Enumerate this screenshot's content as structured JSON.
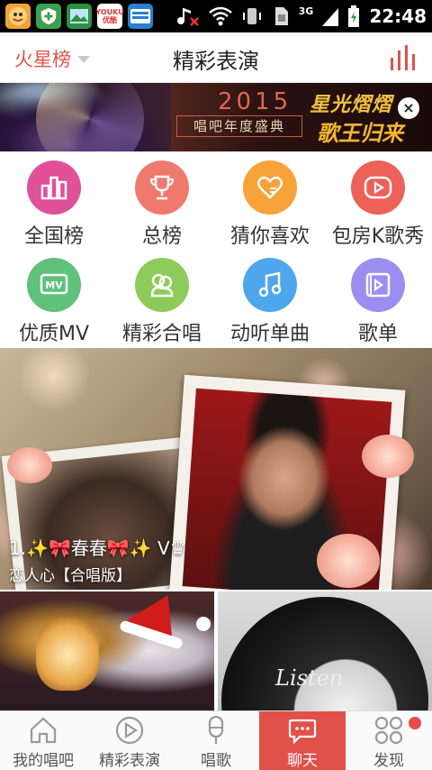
{
  "status_bar": {
    "time": "22:48",
    "network": "3G",
    "apps": [
      {
        "icon": "game-app-icon",
        "color": "#f0a43a"
      },
      {
        "icon": "security-app-icon",
        "color": "#3aa14a"
      },
      {
        "icon": "gallery-app-icon",
        "color": "#2f8f3f"
      },
      {
        "icon": "youku-app-icon",
        "color": "#ffffff",
        "text": "YOUKU 优酷"
      },
      {
        "icon": "store-app-icon",
        "color": "#2a7fd3"
      }
    ]
  },
  "header": {
    "left_label": "火星榜",
    "title": "精彩表演",
    "right_icon": "chart-icon"
  },
  "banner": {
    "year": "2015",
    "subtitle": "唱吧年度盛典",
    "calligraphy_line1": "星光熠熠",
    "calligraphy_line2": "歌王归来",
    "close_symbol": "×"
  },
  "categories": [
    {
      "label": "全国榜",
      "icon": "chart-icon",
      "color": "#e0519a"
    },
    {
      "label": "总榜",
      "icon": "trophy-icon",
      "color": "#f0796d"
    },
    {
      "label": "猜你喜欢",
      "icon": "heart-icon",
      "color": "#f8a23a"
    },
    {
      "label": "包房K歌秀",
      "icon": "play-icon",
      "color": "#ec6158"
    },
    {
      "label": "优质MV",
      "icon": "mv-icon",
      "color": "#5fc17a"
    },
    {
      "label": "精彩合唱",
      "icon": "duet-icon",
      "color": "#8ecb5a"
    },
    {
      "label": "动听单曲",
      "icon": "music-note-icon",
      "color": "#4ea6ec"
    },
    {
      "label": "歌单",
      "icon": "playlist-icon",
      "color": "#9a8ff0"
    }
  ],
  "featured": {
    "caption_line1": "1.✨🎀春春🎀✨ V♛",
    "caption_line2": "恋人心【合唱版】"
  },
  "thumbnails": [
    {
      "name": "thumb-left",
      "overlay_text": ""
    },
    {
      "name": "thumb-right",
      "overlay_text": "Listen"
    }
  ],
  "bottom_nav": [
    {
      "label": "我的唱吧",
      "icon": "home-icon",
      "active": false
    },
    {
      "label": "精彩表演",
      "icon": "play-circle-icon",
      "active": false
    },
    {
      "label": "唱歌",
      "icon": "microphone-icon",
      "active": false
    },
    {
      "label": "聊天",
      "icon": "chat-icon",
      "active": true
    },
    {
      "label": "发现",
      "icon": "discover-icon",
      "active": false,
      "badge": true
    }
  ],
  "colors": {
    "accent": "#e0514a",
    "status_bar": "#000000"
  }
}
